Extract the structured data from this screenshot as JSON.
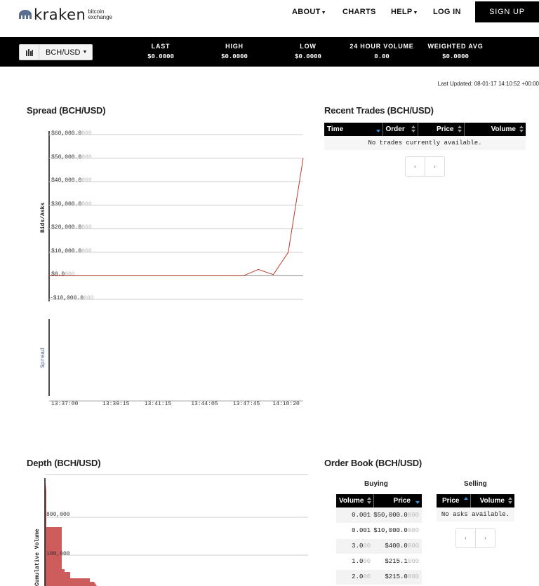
{
  "header": {
    "logo_word": "kraken",
    "logo_sub_1": "bitcoin",
    "logo_sub_2": "exchange",
    "nav": {
      "about": "ABOUT",
      "charts": "CHARTS",
      "help": "HELP",
      "login": "LOG IN",
      "signup": "SIGN UP"
    }
  },
  "ticker": {
    "pair": "BCH/USD",
    "cols": [
      {
        "label": "LAST",
        "value": "$0.0000"
      },
      {
        "label": "HIGH",
        "value": "$0.0000"
      },
      {
        "label": "LOW",
        "value": "$0.0000"
      },
      {
        "label": "24 HOUR VOLUME",
        "value": "0.00"
      },
      {
        "label": "WEIGHTED AVG",
        "value": "$0.0000"
      }
    ]
  },
  "last_updated": "Last Updated: 08-01-17 14:10:52 +00:00",
  "spread": {
    "title": "Spread (BCH/USD)",
    "ylabel": "Bids/Asks",
    "spread_label": "Spread",
    "ytick_main": [
      "$60,000.0",
      "$50,000.0",
      "$40,000.0",
      "$30,000.0",
      "$20,000.0",
      "$10,000.0",
      "$0.0",
      "-$10,000.0"
    ],
    "ytick_dim": [
      "000",
      "000",
      "000",
      "000",
      "000",
      "000",
      "000",
      "000"
    ],
    "xticks": [
      "13:37:00",
      "13:39:15",
      "13:41:15",
      "13:44:05",
      "13:47:45",
      "14:10:20"
    ]
  },
  "recent_trades": {
    "title": "Recent Trades (BCH/USD)",
    "headers": [
      "Time",
      "Order",
      "Price",
      "Volume"
    ],
    "empty": "No trades currently available.",
    "pager_prev": "‹",
    "pager_next": "›"
  },
  "depth": {
    "title": "Depth (BCH/USD)",
    "ylabel": "Cumulative Volume",
    "ytick_1": "800,000",
    "ytick_2": "100,000"
  },
  "order_book": {
    "title": "Order Book (BCH/USD)",
    "buying": "Buying",
    "selling": "Selling",
    "buy_headers": [
      "Volume",
      "Price"
    ],
    "sell_headers": [
      "Price",
      "Volume"
    ],
    "buy_rows": [
      {
        "vol": "0.001",
        "price": "$50,000.0",
        "price_dim": "000"
      },
      {
        "vol": "0.001",
        "price": "$10,000.0",
        "price_dim": "000"
      },
      {
        "vol": "3.0",
        "vol_dim": "00",
        "price": "$400.0",
        "price_dim": "000"
      },
      {
        "vol": "1.0",
        "vol_dim": "00",
        "price": "$215.1",
        "price_dim": "000"
      },
      {
        "vol": "2.0",
        "vol_dim": "00",
        "price": "$215.0",
        "price_dim": "000"
      }
    ],
    "sell_empty": "No asks available.",
    "pager_prev": "‹",
    "pager_next": "›"
  },
  "chart_data": [
    {
      "type": "line",
      "title": "Spread (BCH/USD)",
      "ylabel": "Bids/Asks",
      "ylim": [
        -10000,
        60000
      ],
      "xticks": [
        "13:37:00",
        "13:39:15",
        "13:41:15",
        "13:44:05",
        "13:47:45",
        "14:10:20"
      ],
      "series": [
        {
          "values": [
            0,
            0,
            0,
            0,
            0,
            0,
            0,
            0,
            0,
            0,
            0,
            0,
            0,
            0,
            2700,
            500,
            10000,
            50000
          ]
        }
      ],
      "color": "#c0392b"
    },
    {
      "type": "area",
      "title": "Depth (BCH/USD)",
      "ylabel": "Cumulative Volume",
      "color": "#cd5c5c"
    }
  ]
}
